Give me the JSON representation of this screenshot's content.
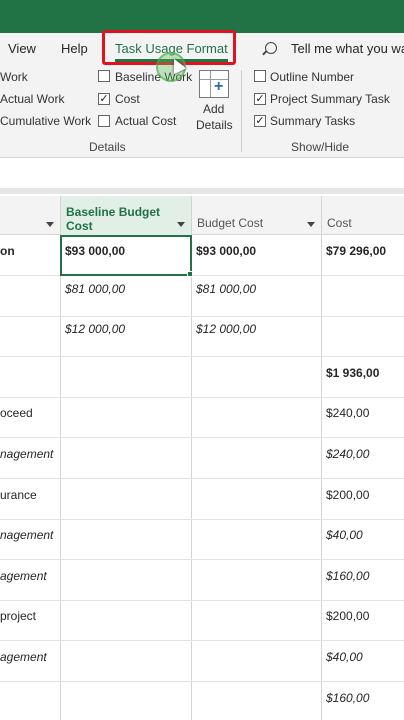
{
  "ribbon": {
    "tabs": [
      "View",
      "Help",
      "Task Usage Format"
    ],
    "active_tab": "Task Usage Format",
    "tell_me": "Tell me what you wa",
    "details_group": {
      "label": "Details",
      "col1": [
        "Work",
        "Actual Work",
        "Cumulative Work"
      ],
      "col2": [
        {
          "label": "Baseline Work",
          "checked": false
        },
        {
          "label": "Cost",
          "checked": true
        },
        {
          "label": "Actual Cost",
          "checked": false
        }
      ],
      "add_details_line1": "Add",
      "add_details_line2": "Details"
    },
    "showhide_group": {
      "label": "Show/Hide",
      "items": [
        {
          "label": "Outline Number",
          "checked": false
        },
        {
          "label": "Project Summary Task",
          "checked": true
        },
        {
          "label": "Summary Tasks",
          "checked": true
        }
      ]
    },
    "check_mark": "✓"
  },
  "grid": {
    "headers": [
      {
        "line1": "",
        "line2": ""
      },
      {
        "line1": "Baseline Budget",
        "line2": "Cost"
      },
      {
        "line1": "Budget Cost",
        "line2": ""
      },
      {
        "line1": "Cost",
        "line2": ""
      }
    ],
    "rows": [
      {
        "name": "on",
        "baseline": "$93 000,00",
        "budget": "$93 000,00",
        "cost": "$79 296,00",
        "style": "bold"
      },
      {
        "name": "",
        "baseline": "$81 000,00",
        "budget": "$81 000,00",
        "cost": "",
        "style": "italic"
      },
      {
        "name": "",
        "baseline": "$12 000,00",
        "budget": "$12 000,00",
        "cost": "",
        "style": "italic"
      },
      {
        "name": "",
        "baseline": "",
        "budget": "",
        "cost": "$1 936,00",
        "style": "bold"
      },
      {
        "name": "oceed",
        "baseline": "",
        "budget": "",
        "cost": "$240,00",
        "style": "normal"
      },
      {
        "name": "nagement",
        "baseline": "",
        "budget": "",
        "cost": "$240,00",
        "style": "italic"
      },
      {
        "name": "urance",
        "baseline": "",
        "budget": "",
        "cost": "$200,00",
        "style": "normal"
      },
      {
        "name": "nagement",
        "baseline": "",
        "budget": "",
        "cost": "$40,00",
        "style": "italic"
      },
      {
        "name": "agement",
        "baseline": "",
        "budget": "",
        "cost": "$160,00",
        "style": "italic"
      },
      {
        "name": "project",
        "baseline": "",
        "budget": "",
        "cost": "$200,00",
        "style": "normal"
      },
      {
        "name": "agement",
        "baseline": "",
        "budget": "",
        "cost": "$40,00",
        "style": "italic"
      },
      {
        "name": "",
        "baseline": "",
        "budget": "",
        "cost": "$160,00",
        "style": "italic"
      }
    ]
  }
}
